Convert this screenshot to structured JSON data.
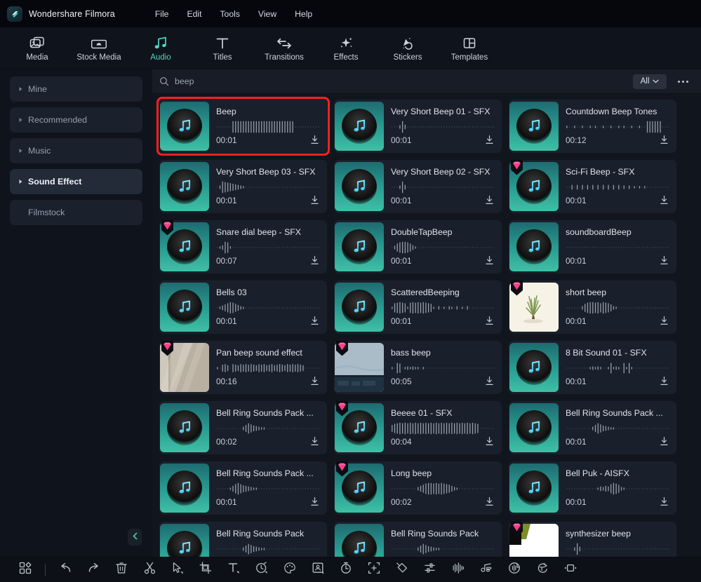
{
  "titlebar": {
    "logo_icon": "filmora-logo-icon",
    "app_title": "Wondershare Filmora",
    "menus": [
      "File",
      "Edit",
      "Tools",
      "View",
      "Help"
    ]
  },
  "ribbon": {
    "items": [
      {
        "label": "Media",
        "icon": "media-icon",
        "active": false
      },
      {
        "label": "Stock Media",
        "icon": "stock-media-icon",
        "active": false
      },
      {
        "label": "Audio",
        "icon": "audio-note-icon",
        "active": true
      },
      {
        "label": "Titles",
        "icon": "titles-icon",
        "active": false
      },
      {
        "label": "Transitions",
        "icon": "transitions-icon",
        "active": false
      },
      {
        "label": "Effects",
        "icon": "effects-icon",
        "active": false
      },
      {
        "label": "Stickers",
        "icon": "stickers-icon",
        "active": false
      },
      {
        "label": "Templates",
        "icon": "templates-icon",
        "active": false
      }
    ],
    "active_color": "#4fd6c0"
  },
  "sidebar": {
    "items": [
      {
        "label": "Mine",
        "expandable": true,
        "selected": false
      },
      {
        "label": "Recommended",
        "expandable": true,
        "selected": false
      },
      {
        "label": "Music",
        "expandable": true,
        "selected": false
      },
      {
        "label": "Sound Effect",
        "expandable": true,
        "selected": true
      },
      {
        "label": "Filmstock",
        "expandable": false,
        "selected": false
      }
    ],
    "collapse_icon": "chevron-left-icon"
  },
  "search": {
    "icon": "search-icon",
    "value": "beep",
    "placeholder": "Search",
    "filter_label": "All",
    "filter_chevron_icon": "chevron-down-icon",
    "more_icon": "more-options-icon"
  },
  "results": {
    "highlight_color": "#ff2020",
    "premium_badge_color": "#ff3d8b",
    "download_icon": "download-icon",
    "cards": [
      {
        "title": "Beep",
        "duration": "00:01",
        "premium": false,
        "thumb": "music-note",
        "highlight": true,
        "wave": "m"
      },
      {
        "title": "Very Short Beep 01 - SFX",
        "duration": "00:01",
        "premium": false,
        "thumb": "music-note",
        "highlight": false,
        "wave": "a"
      },
      {
        "title": "Countdown Beep Tones",
        "duration": "00:12",
        "premium": false,
        "thumb": "music-note",
        "highlight": false,
        "wave": "c"
      },
      {
        "title": "Very Short Beep 03 - SFX",
        "duration": "00:01",
        "premium": false,
        "thumb": "music-note",
        "highlight": false,
        "wave": "b"
      },
      {
        "title": "Very Short Beep 02 - SFX",
        "duration": "00:01",
        "premium": false,
        "thumb": "music-note",
        "highlight": false,
        "wave": "a"
      },
      {
        "title": "Sci-Fi Beep - SFX",
        "duration": "00:01",
        "premium": true,
        "thumb": "music-note",
        "highlight": false,
        "wave": "d"
      },
      {
        "title": "Snare dial beep - SFX",
        "duration": "00:07",
        "premium": true,
        "thumb": "music-note",
        "highlight": false,
        "wave": "e"
      },
      {
        "title": "DoubleTapBeep",
        "duration": "00:01",
        "premium": false,
        "thumb": "music-note",
        "highlight": false,
        "wave": "f"
      },
      {
        "title": "soundboardBeep",
        "duration": "00:01",
        "premium": false,
        "thumb": "music-note",
        "highlight": false,
        "wave": "g"
      },
      {
        "title": "Bells 03",
        "duration": "00:01",
        "premium": false,
        "thumb": "music-note",
        "highlight": false,
        "wave": "h"
      },
      {
        "title": "ScatteredBeeping",
        "duration": "00:01",
        "premium": false,
        "thumb": "music-note",
        "highlight": false,
        "wave": "i"
      },
      {
        "title": "short beep",
        "duration": "00:01",
        "premium": true,
        "thumb": "photo-plant",
        "highlight": false,
        "wave": "j"
      },
      {
        "title": "Pan beep sound effect",
        "duration": "00:16",
        "premium": true,
        "thumb": "photo-door",
        "highlight": false,
        "wave": "k"
      },
      {
        "title": "bass beep",
        "duration": "00:05",
        "premium": true,
        "thumb": "photo-wall",
        "highlight": false,
        "wave": "l"
      },
      {
        "title": "8 Bit Sound 01 - SFX",
        "duration": "00:01",
        "premium": false,
        "thumb": "music-note",
        "highlight": false,
        "wave": "n"
      },
      {
        "title": "Bell Ring Sounds Pack ...",
        "duration": "00:02",
        "premium": false,
        "thumb": "music-note",
        "highlight": false,
        "wave": "o"
      },
      {
        "title": "Beeee 01 - SFX",
        "duration": "00:04",
        "premium": true,
        "thumb": "music-note",
        "highlight": false,
        "wave": "p"
      },
      {
        "title": "Bell Ring Sounds Pack ...",
        "duration": "00:01",
        "premium": false,
        "thumb": "music-note",
        "highlight": false,
        "wave": "o"
      },
      {
        "title": "Bell Ring Sounds Pack ...",
        "duration": "00:01",
        "premium": false,
        "thumb": "music-note",
        "highlight": false,
        "wave": "q"
      },
      {
        "title": "Long beep",
        "duration": "00:02",
        "premium": true,
        "thumb": "music-note",
        "highlight": false,
        "wave": "r"
      },
      {
        "title": "Bell Puk - AISFX",
        "duration": "00:01",
        "premium": false,
        "thumb": "music-note",
        "highlight": false,
        "wave": "s"
      },
      {
        "title": "Bell Ring Sounds Pack",
        "duration": "",
        "premium": false,
        "thumb": "music-note",
        "highlight": false,
        "wave": "o"
      },
      {
        "title": "Bell Ring Sounds Pack",
        "duration": "",
        "premium": false,
        "thumb": "music-note",
        "highlight": false,
        "wave": "o"
      },
      {
        "title": "synthesizer beep",
        "duration": "",
        "premium": true,
        "thumb": "photo-white",
        "highlight": false,
        "wave": "a"
      }
    ]
  },
  "bottom_toolbar": {
    "icons": [
      "apps-grid-icon",
      "separator",
      "undo-icon",
      "redo-icon",
      "delete-icon",
      "cut-scissors-icon",
      "cursor-select-icon",
      "crop-icon",
      "text-tool-icon",
      "speed-icon",
      "color-palette-icon",
      "picture-in-picture-icon",
      "timer-icon",
      "add-marker-icon",
      "mask-icon",
      "adjust-sliders-icon",
      "audio-waveform-icon",
      "keyframe-icon",
      "auto-reframe-icon",
      "text-rotate-icon",
      "split-screen-icon"
    ]
  }
}
